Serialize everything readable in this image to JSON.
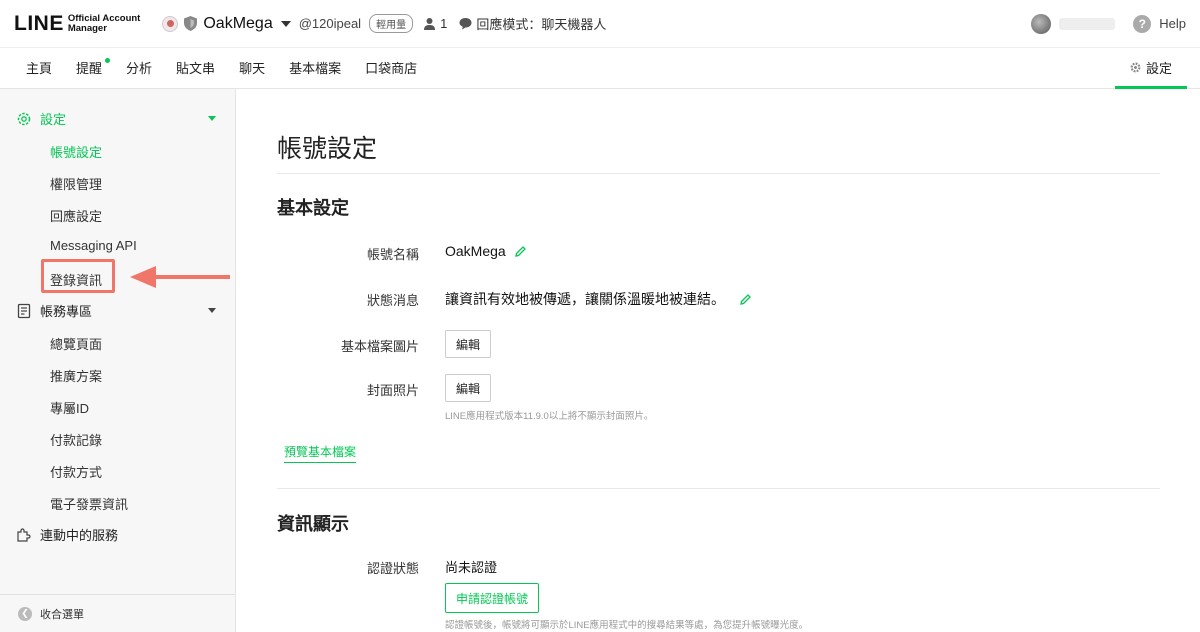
{
  "header": {
    "logo_main": "LINE",
    "logo_sub_1": "Official Account",
    "logo_sub_2": "Manager",
    "account_name": "OakMega",
    "account_id": "@120ipeal",
    "plan_badge": "輕用量",
    "member_count": "1",
    "response_mode": "回應模式：聊天機器人",
    "help": "Help"
  },
  "nav": {
    "items": [
      "主頁",
      "提醒",
      "分析",
      "貼文串",
      "聊天",
      "基本檔案",
      "口袋商店"
    ],
    "settings": "設定"
  },
  "sidebar": {
    "group_settings": "設定",
    "settings_items": [
      "帳號設定",
      "權限管理",
      "回應設定",
      "Messaging API",
      "登錄資訊"
    ],
    "group_billing": "帳務專區",
    "billing_items": [
      "總覽頁面",
      "推廣方案",
      "專屬ID",
      "付款記錄",
      "付款方式",
      "電子發票資訊"
    ],
    "group_services": "連動中的服務",
    "collapse": "收合選單"
  },
  "main": {
    "page_title": "帳號設定",
    "basic_section": "基本設定",
    "account_name_label": "帳號名稱",
    "account_name_value": "OakMega",
    "status_label": "狀態消息",
    "status_value": "讓資訊有效地被傳遞，讓關係溫暖地被連結。",
    "profile_image_label": "基本檔案圖片",
    "edit_label": "編輯",
    "cover_label": "封面照片",
    "cover_note": "LINE應用程式版本11.9.0以上將不顯示封面照片。",
    "preview_link": "預覽基本檔案",
    "info_section": "資訊顯示",
    "verify_label": "認證狀態",
    "verify_value": "尚未認證",
    "verify_button": "申請認證帳號",
    "verify_note": "認證帳號後，帳號將可顯示於LINE應用程式中的搜尋結果等處，為您提升帳號曝光度。"
  },
  "colors": {
    "accent": "#06c755",
    "highlight": "#f0766a"
  }
}
